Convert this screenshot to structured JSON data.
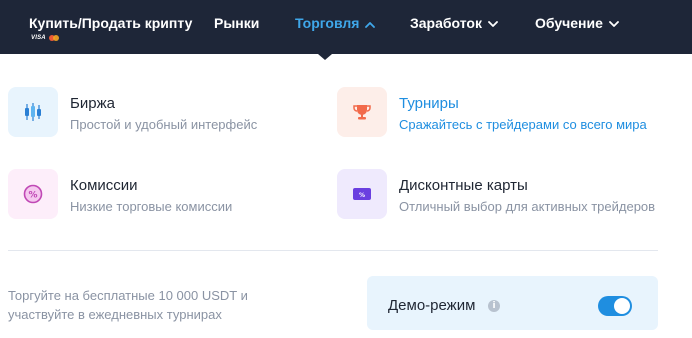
{
  "nav": {
    "buy_sell": "Купить/Продать крипту",
    "payment_visa": "VISA",
    "markets": "Рынки",
    "trading": "Торговля",
    "earn": "Заработок",
    "learn": "Обучение"
  },
  "menu": {
    "exchange": {
      "title": "Биржа",
      "desc": "Простой и удобный интерфейс",
      "icon": "candlestick-icon"
    },
    "tournaments": {
      "title": "Турниры",
      "desc": "Сражайтесь с трейдерами со всего мира",
      "icon": "trophy-icon"
    },
    "fees": {
      "title": "Комиссии",
      "desc": "Низкие торговые комиссии",
      "icon": "percent-circle-icon"
    },
    "discount": {
      "title": "Дисконтные карты",
      "desc": "Отличный выбор для активных трейдеров",
      "icon": "discount-card-icon"
    }
  },
  "promo": {
    "text": "Торгуйте на бесплатные 10 000 USDT и участвуйте в ежедневных турнирах"
  },
  "demo": {
    "label": "Демо-режим",
    "info": "i",
    "enabled": true
  },
  "colors": {
    "nav_bg": "#1e2638",
    "accent": "#1f8ee0",
    "active_nav": "#3fa7ea",
    "exchange_icon_bg": "#e8f4fd",
    "tournament_icon_bg": "#fdeee9",
    "fees_icon_bg": "#fdeefa",
    "discount_icon_bg": "#efeafd"
  },
  "icons": {
    "fees_symbol": "%",
    "discount_symbol": "%"
  }
}
